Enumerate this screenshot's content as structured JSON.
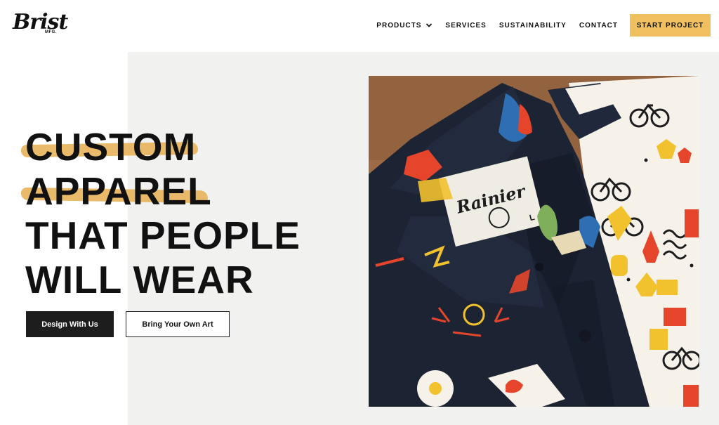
{
  "brand": {
    "logo_script": "Brist",
    "logo_sub": "MFG."
  },
  "nav": {
    "items": [
      {
        "label": "PRODUCTS",
        "has_dropdown": true
      },
      {
        "label": "SERVICES"
      },
      {
        "label": "SUSTAINABILITY"
      },
      {
        "label": "CONTACT"
      }
    ],
    "cta_label": "START PROJECT"
  },
  "hero": {
    "headline_lines": [
      "CUSTOM",
      "APPAREL",
      "THAT PEOPLE",
      "WILL WEAR"
    ],
    "primary_button": "Design With Us",
    "secondary_button": "Bring Your Own Art"
  },
  "photo": {
    "label_brand": "Rainier",
    "label_side": "BREWING CO. MOUNTAIN FRESH COLLECTION",
    "label_size": "L"
  },
  "colors": {
    "accent": "#f0c060",
    "brush": "#e7b45c",
    "hero_bg": "#f1f1ef",
    "dark": "#1d1d1d"
  }
}
